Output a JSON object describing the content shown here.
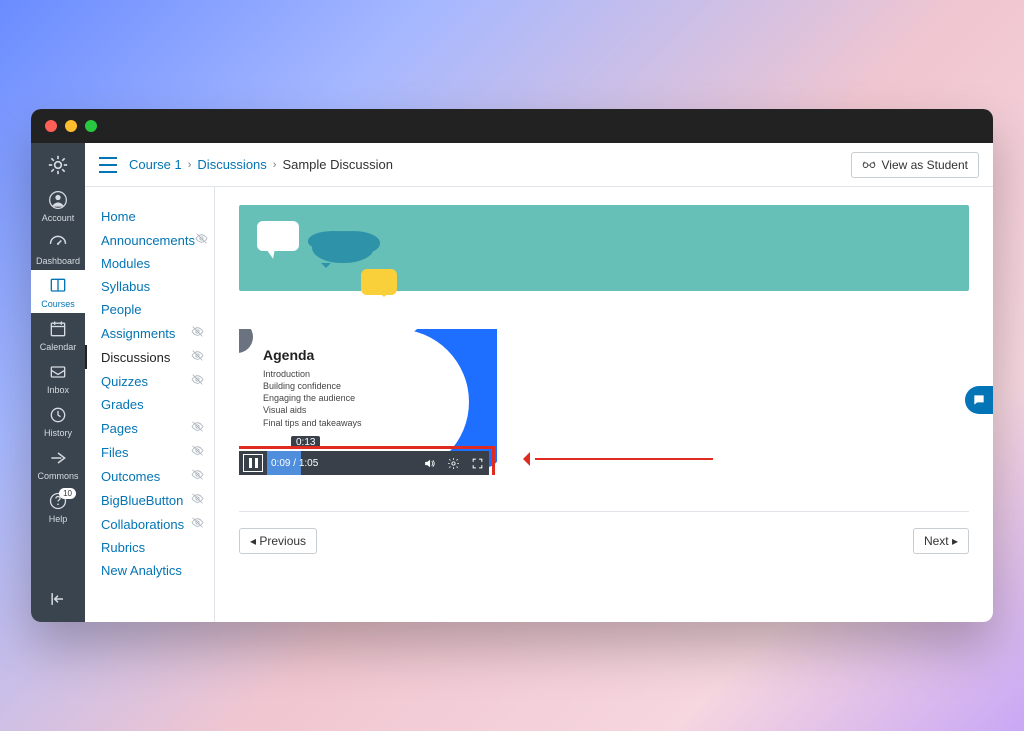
{
  "globalnav": {
    "items": [
      {
        "key": "account",
        "label": "Account"
      },
      {
        "key": "dashboard",
        "label": "Dashboard"
      },
      {
        "key": "courses",
        "label": "Courses"
      },
      {
        "key": "calendar",
        "label": "Calendar"
      },
      {
        "key": "inbox",
        "label": "Inbox"
      },
      {
        "key": "history",
        "label": "History"
      },
      {
        "key": "commons",
        "label": "Commons"
      },
      {
        "key": "help",
        "label": "Help",
        "badge": "10"
      }
    ]
  },
  "breadcrumbs": {
    "course": "Course 1",
    "section": "Discussions",
    "page": "Sample Discussion"
  },
  "header": {
    "view_as_student": "View as Student"
  },
  "coursenav": {
    "items": [
      {
        "label": "Home",
        "hidden": false
      },
      {
        "label": "Announcements",
        "hidden": true
      },
      {
        "label": "Modules",
        "hidden": false
      },
      {
        "label": "Syllabus",
        "hidden": false
      },
      {
        "label": "People",
        "hidden": false
      },
      {
        "label": "Assignments",
        "hidden": true
      },
      {
        "label": "Discussions",
        "hidden": true,
        "active": true
      },
      {
        "label": "Quizzes",
        "hidden": true
      },
      {
        "label": "Grades",
        "hidden": false
      },
      {
        "label": "Pages",
        "hidden": true
      },
      {
        "label": "Files",
        "hidden": true
      },
      {
        "label": "Outcomes",
        "hidden": true
      },
      {
        "label": "BigBlueButton",
        "hidden": true
      },
      {
        "label": "Collaborations",
        "hidden": true
      },
      {
        "label": "Rubrics",
        "hidden": false
      },
      {
        "label": "New Analytics",
        "hidden": false
      }
    ]
  },
  "video": {
    "title": "Agenda",
    "lines": [
      "Introduction",
      "Building confidence",
      "Engaging the audience",
      "Visual aids",
      "Final tips and takeaways"
    ],
    "tooltip_time": "0:13",
    "current_time": "0:09",
    "duration": "1:05"
  },
  "pager": {
    "prev": "Previous",
    "next": "Next"
  }
}
